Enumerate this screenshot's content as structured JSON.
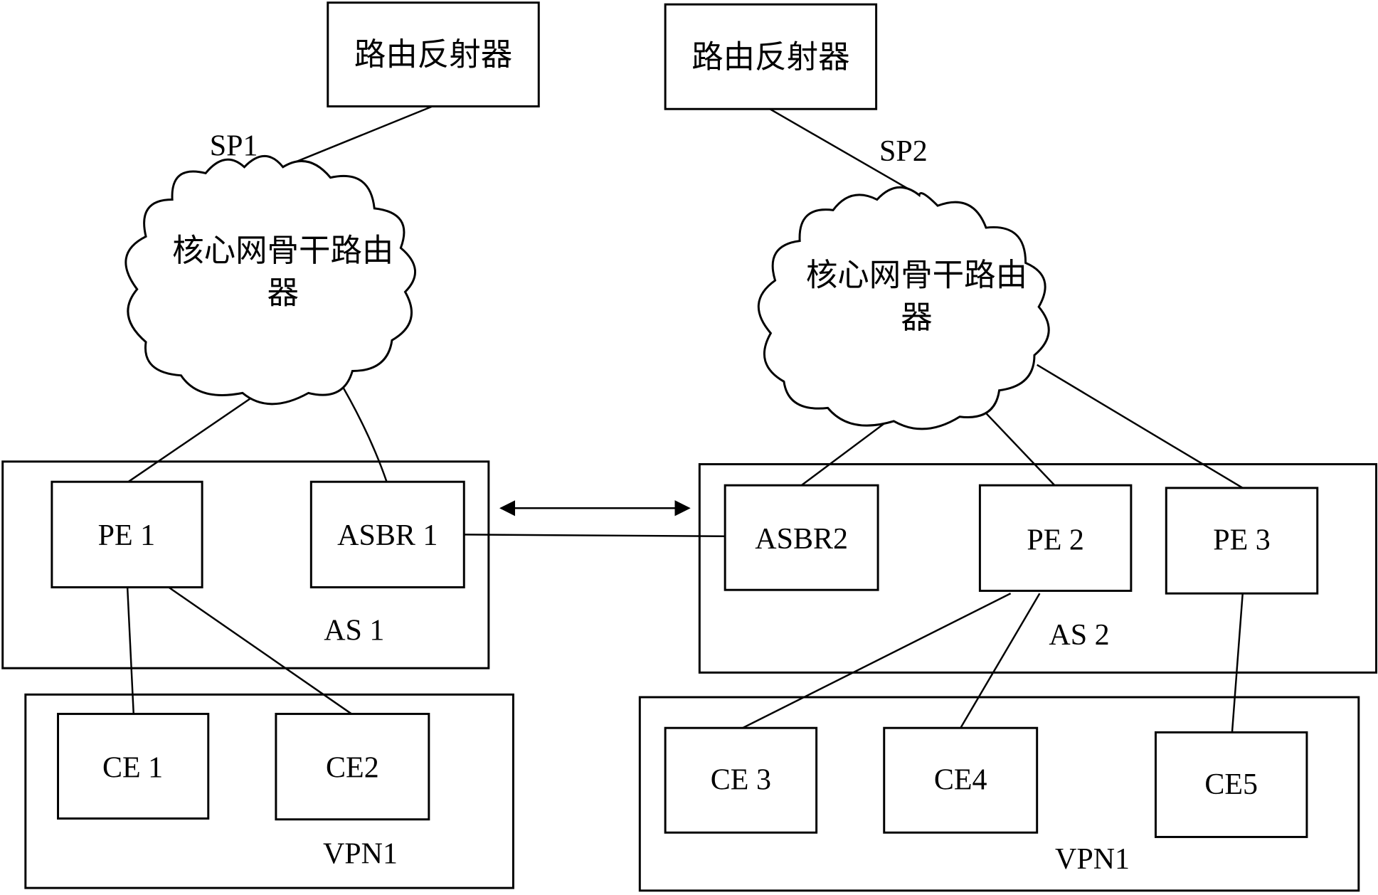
{
  "diagram": {
    "type": "network-topology",
    "left": {
      "route_reflector": "路由反射器",
      "provider_label": "SP1",
      "core_cloud": {
        "line1": "核心网骨干路由",
        "line2": "器"
      },
      "as_group": {
        "label": "AS 1",
        "nodes": [
          "PE 1",
          "ASBR 1"
        ]
      },
      "vpn_group": {
        "label": "VPN1",
        "nodes": [
          "CE 1",
          "CE2"
        ]
      }
    },
    "right": {
      "route_reflector": "路由反射器",
      "provider_label": "SP2",
      "core_cloud": {
        "line1": "核心网骨干路由",
        "line2": "器"
      },
      "as_group": {
        "label": "AS 2",
        "nodes": [
          "ASBR2",
          "PE 2",
          "PE 3"
        ]
      },
      "vpn_group": {
        "label": "VPN1",
        "nodes": [
          "CE 3",
          "CE4",
          "CE5"
        ]
      }
    },
    "connections": [
      [
        "SP1 route reflector",
        "SP1 core"
      ],
      [
        "SP1 core",
        "PE 1"
      ],
      [
        "SP1 core",
        "ASBR 1"
      ],
      [
        "PE 1",
        "CE 1"
      ],
      [
        "PE 1",
        "CE2"
      ],
      [
        "ASBR 1",
        "ASBR2"
      ],
      [
        "SP2 route reflector",
        "SP2 core"
      ],
      [
        "SP2 core",
        "ASBR2"
      ],
      [
        "SP2 core",
        "PE 2"
      ],
      [
        "SP2 core",
        "PE 3"
      ],
      [
        "PE 2",
        "CE 3"
      ],
      [
        "PE 2",
        "CE4"
      ],
      [
        "PE 3",
        "CE5"
      ]
    ],
    "bidirectional_arrow": {
      "from": "AS 1",
      "to": "AS 2"
    }
  }
}
